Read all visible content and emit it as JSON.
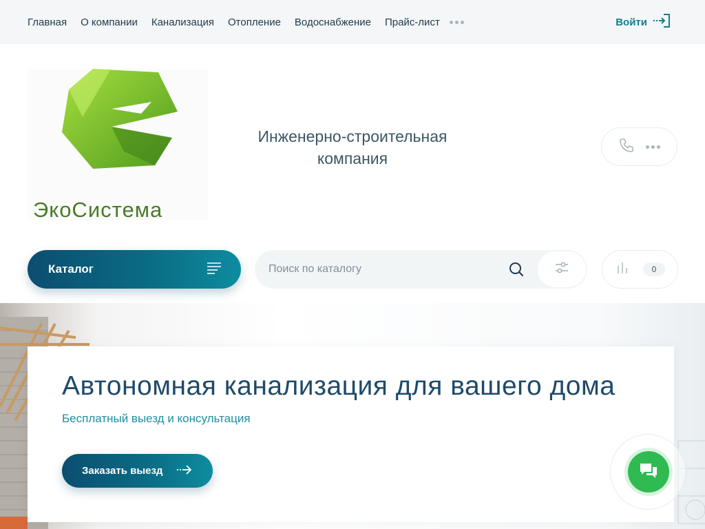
{
  "nav": {
    "items": [
      {
        "label": "Главная"
      },
      {
        "label": "О компании"
      },
      {
        "label": "Канализация"
      },
      {
        "label": "Отопление"
      },
      {
        "label": "Водоснабжение"
      },
      {
        "label": "Прайс-лист"
      }
    ],
    "login_label": "Войти"
  },
  "header": {
    "logo_text": "ЭкоСистема",
    "tagline_line1": "Инженерно-строительная",
    "tagline_line2": "компания"
  },
  "toolbar": {
    "catalog_label": "Каталог",
    "search_placeholder": "Поиск по каталогу",
    "compare_count": "0"
  },
  "hero": {
    "title": "Автономная канализация для вашего дома",
    "subtitle": "Бесплатный выезд и консультация",
    "button_label": "Заказать выезд"
  },
  "colors": {
    "accent": "#0a6e86",
    "accent_dark": "#0b4d70",
    "teal_text": "#1f8ea0",
    "chat_green": "#2fba52",
    "logo_green": "#7cc834"
  },
  "icons": [
    "login-icon",
    "phone-icon",
    "more-icon",
    "menu-lines-icon",
    "search-icon",
    "filter-icon",
    "compare-chart-icon",
    "arrow-right-icon",
    "chat-icon"
  ]
}
